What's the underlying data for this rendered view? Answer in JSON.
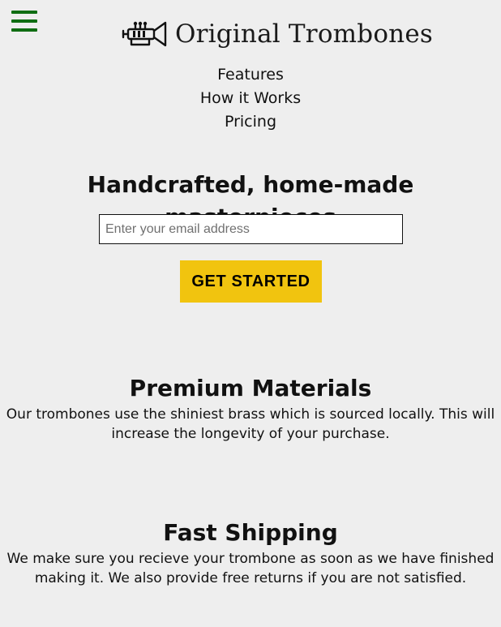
{
  "header": {
    "menu_icon": "hamburger-menu-icon",
    "logo_icon": "trumpet-icon",
    "logo_text": "Original Trombones"
  },
  "nav": {
    "items": [
      {
        "label": "Features"
      },
      {
        "label": "How it Works"
      },
      {
        "label": "Pricing"
      }
    ]
  },
  "hero": {
    "title": "Handcrafted, home-made masterpieces",
    "email_placeholder": "Enter your email address",
    "email_value": "",
    "cta_label": "GET STARTED"
  },
  "features": [
    {
      "title": "Premium Materials",
      "description": "Our trombones use the shiniest brass which is sourced locally. This will increase the longevity of your purchase."
    },
    {
      "title": "Fast Shipping",
      "description": "We make sure you recieve your trombone as soon as we have finished making it. We also provide free returns if you are not satisfied."
    }
  ],
  "colors": {
    "background": "#eeeeee",
    "menu_icon": "#0f6d12",
    "cta_background": "#f1c40f",
    "text": "#111111"
  }
}
